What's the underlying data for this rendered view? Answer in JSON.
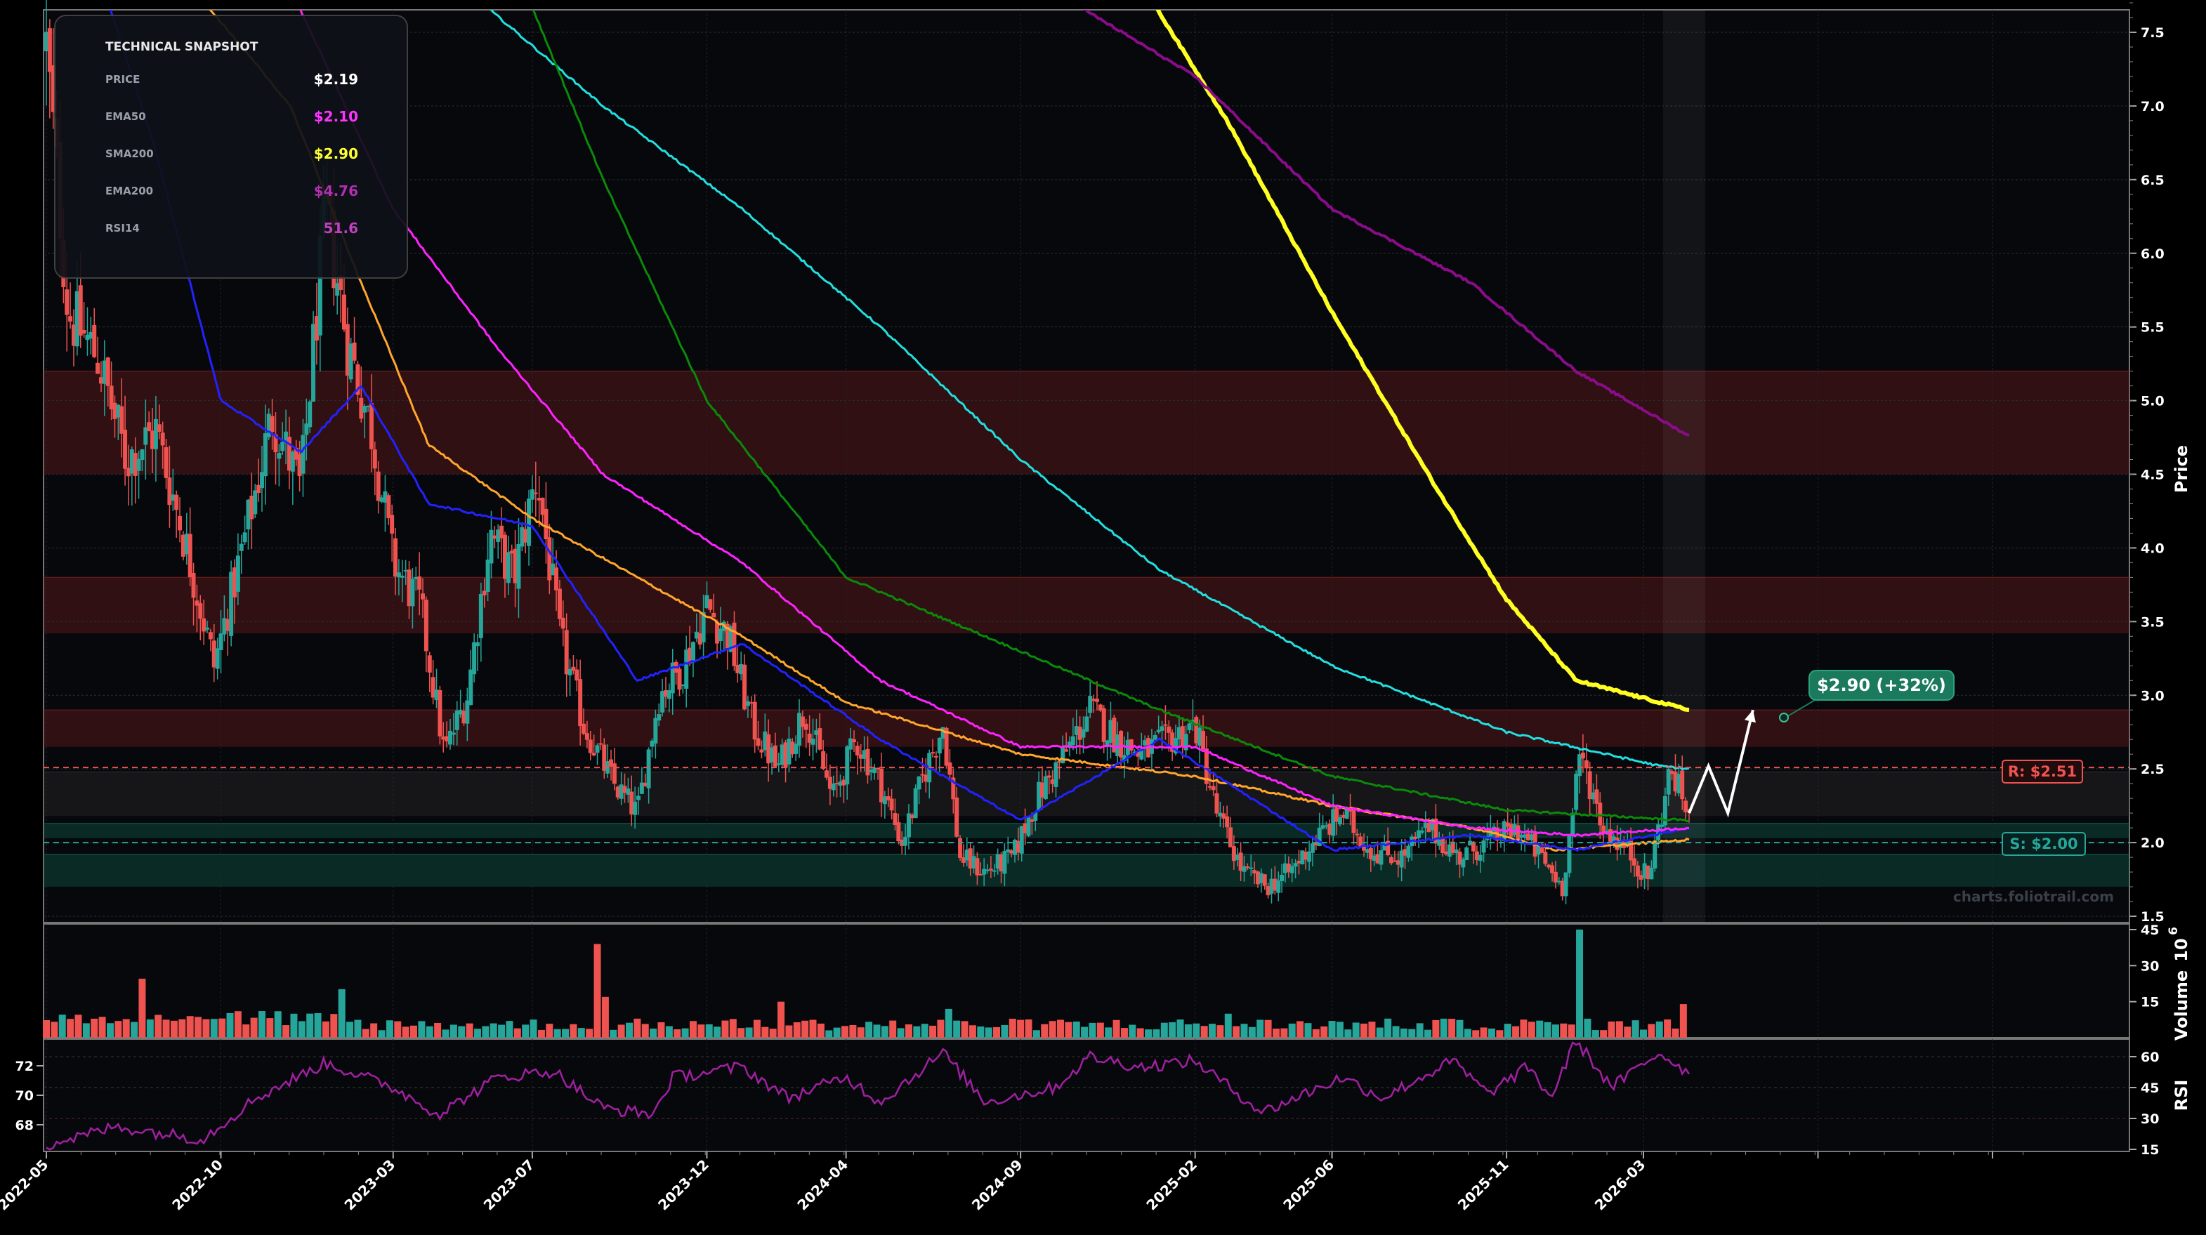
{
  "chart_data": {
    "type": "candlestick",
    "watermark": "charts.foliotrail.com",
    "price_axis": {
      "label": "Price",
      "ticks": [
        "1.5",
        "2.0",
        "2.5",
        "3.0",
        "3.5",
        "4.0",
        "4.5",
        "5.0",
        "5.5",
        "6.0",
        "6.5",
        "7.0",
        "7.5"
      ],
      "ylim": [
        1.45,
        7.85
      ]
    },
    "volume_axis": {
      "label": "Volume",
      "exponent": "1e6",
      "exponent_label": "6",
      "base_label": "10",
      "ticks": [
        "15",
        "30",
        "45"
      ],
      "ylim": [
        0,
        48
      ]
    },
    "rsi_axis": {
      "label": "RSI",
      "ticks_right": [
        "15",
        "30",
        "45",
        "60"
      ],
      "ticks_left": [
        "68",
        "70",
        "72"
      ],
      "ylim": [
        12,
        70
      ]
    },
    "x_ticks": [
      "2022-05",
      "2022-10",
      "2023-03",
      "2023-07",
      "2023-12",
      "2024-04",
      "2024-09",
      "2025-02",
      "2025-06",
      "2025-11",
      "2026-03"
    ],
    "snapshot": {
      "title": "TECHNICAL SNAPSHOT",
      "rows": [
        {
          "label": "PRICE",
          "value": "$2.19",
          "color": "#ffffff"
        },
        {
          "label": "EMA50",
          "value": "$2.10",
          "color": "#ff33ff"
        },
        {
          "label": "SMA200",
          "value": "$2.90",
          "color": "#ffff33"
        },
        {
          "label": "EMA200",
          "value": "$4.76",
          "color": "#b030b0"
        },
        {
          "label": "RSI14",
          "value": "51.6",
          "color": "#c040c0"
        }
      ]
    },
    "levels": {
      "resistance": {
        "label": "R: $2.51",
        "value": 2.51,
        "color": "#ef5350"
      },
      "support": {
        "label": "S: $2.00",
        "value": 2.0,
        "color": "#26a69a"
      }
    },
    "target": {
      "label": "$2.90 (+32%)",
      "value": 2.9,
      "color": "#1b7a5c"
    },
    "zones": [
      {
        "type": "resistance",
        "from": 4.5,
        "to": 5.2
      },
      {
        "type": "resistance",
        "from": 3.42,
        "to": 3.8
      },
      {
        "type": "resistance",
        "from": 2.65,
        "to": 2.9
      },
      {
        "type": "neutral",
        "from": 2.18,
        "to": 2.48
      },
      {
        "type": "support",
        "from": 2.03,
        "to": 2.13
      },
      {
        "type": "support",
        "from": 1.7,
        "to": 1.92
      }
    ],
    "anchors": [
      {
        "date": "2022-05-01",
        "close": 7.4
      },
      {
        "date": "2022-05-20",
        "close": 5.6
      },
      {
        "date": "2022-06-15",
        "close": 5.3
      },
      {
        "date": "2022-07-10",
        "close": 4.6
      },
      {
        "date": "2022-08-05",
        "close": 4.8
      },
      {
        "date": "2022-09-01",
        "close": 4.0
      },
      {
        "date": "2022-09-25",
        "close": 3.2
      },
      {
        "date": "2022-10-20",
        "close": 4.0
      },
      {
        "date": "2022-11-15",
        "close": 4.9
      },
      {
        "date": "2022-12-10",
        "close": 4.4
      },
      {
        "date": "2023-01-01",
        "close": 6.3
      },
      {
        "date": "2023-01-20",
        "close": 5.4
      },
      {
        "date": "2023-02-10",
        "close": 4.8
      },
      {
        "date": "2023-03-01",
        "close": 3.9
      },
      {
        "date": "2023-03-25",
        "close": 3.6
      },
      {
        "date": "2023-04-15",
        "close": 2.6
      },
      {
        "date": "2023-05-05",
        "close": 3.0
      },
      {
        "date": "2023-05-25",
        "close": 4.1
      },
      {
        "date": "2023-06-15",
        "close": 3.8
      },
      {
        "date": "2023-07-05",
        "close": 4.5
      },
      {
        "date": "2023-07-25",
        "close": 3.4
      },
      {
        "date": "2023-08-15",
        "close": 2.8
      },
      {
        "date": "2023-09-10",
        "close": 2.4
      },
      {
        "date": "2023-10-01",
        "close": 2.2
      },
      {
        "date": "2023-10-20",
        "close": 3.0
      },
      {
        "date": "2023-11-10",
        "close": 3.2
      },
      {
        "date": "2023-12-01",
        "close": 3.6
      },
      {
        "date": "2023-12-20",
        "close": 3.4
      },
      {
        "date": "2024-01-10",
        "close": 2.8
      },
      {
        "date": "2024-02-01",
        "close": 2.5
      },
      {
        "date": "2024-02-25",
        "close": 2.9
      },
      {
        "date": "2024-03-20",
        "close": 2.3
      },
      {
        "date": "2024-04-10",
        "close": 2.7
      },
      {
        "date": "2024-05-01",
        "close": 2.4
      },
      {
        "date": "2024-05-20",
        "close": 2.0
      },
      {
        "date": "2024-06-10",
        "close": 2.5
      },
      {
        "date": "2024-06-25",
        "close": 2.8
      },
      {
        "date": "2024-07-10",
        "close": 1.9
      },
      {
        "date": "2024-08-01",
        "close": 1.8
      },
      {
        "date": "2024-08-25",
        "close": 1.9
      },
      {
        "date": "2024-09-15",
        "close": 2.3
      },
      {
        "date": "2024-10-10",
        "close": 2.6
      },
      {
        "date": "2024-11-01",
        "close": 2.9
      },
      {
        "date": "2024-11-25",
        "close": 2.7
      },
      {
        "date": "2024-12-15",
        "close": 2.6
      },
      {
        "date": "2025-01-10",
        "close": 2.7
      },
      {
        "date": "2025-02-01",
        "close": 2.8
      },
      {
        "date": "2025-02-20",
        "close": 2.2
      },
      {
        "date": "2025-03-15",
        "close": 1.8
      },
      {
        "date": "2025-04-05",
        "close": 1.7
      },
      {
        "date": "2025-04-25",
        "close": 1.8
      },
      {
        "date": "2025-05-15",
        "close": 2.0
      },
      {
        "date": "2025-06-10",
        "close": 2.2
      },
      {
        "date": "2025-07-05",
        "close": 1.95
      },
      {
        "date": "2025-08-01",
        "close": 1.9
      },
      {
        "date": "2025-08-25",
        "close": 2.1
      },
      {
        "date": "2025-09-20",
        "close": 1.9
      },
      {
        "date": "2025-10-15",
        "close": 2.0
      },
      {
        "date": "2025-11-10",
        "close": 2.1
      },
      {
        "date": "2025-12-01",
        "close": 1.9
      },
      {
        "date": "2025-12-20",
        "close": 1.7
      },
      {
        "date": "2026-01-05",
        "close": 2.6
      },
      {
        "date": "2026-01-25",
        "close": 2.1
      },
      {
        "date": "2026-02-15",
        "close": 1.95
      },
      {
        "date": "2026-03-05",
        "close": 1.75
      },
      {
        "date": "2026-03-25",
        "close": 2.5
      },
      {
        "date": "2026-04-10",
        "close": 2.19
      }
    ],
    "ema_lines": {
      "cyan": [
        [
          "2022-05-01",
          9.5
        ],
        [
          "2023-01-01",
          8.6
        ],
        [
          "2023-09-01",
          7.0
        ],
        [
          "2024-01-01",
          6.3
        ],
        [
          "2024-05-01",
          5.5
        ],
        [
          "2024-09-01",
          4.6
        ],
        [
          "2025-01-01",
          3.85
        ],
        [
          "2025-06-01",
          3.2
        ],
        [
          "2025-11-01",
          2.75
        ],
        [
          "2026-03-15",
          2.52
        ],
        [
          "2026-04-10",
          2.5
        ]
      ],
      "green": [
        [
          "2022-05-01",
          14.0
        ],
        [
          "2023-02-01",
          10.5
        ],
        [
          "2023-09-01",
          6.5
        ],
        [
          "2023-12-01",
          5.0
        ],
        [
          "2024-04-01",
          3.8
        ],
        [
          "2024-08-01",
          3.4
        ],
        [
          "2025-01-01",
          2.9
        ],
        [
          "2025-06-01",
          2.45
        ],
        [
          "2025-11-01",
          2.22
        ],
        [
          "2026-04-10",
          2.15
        ]
      ],
      "orange": [
        [
          "2022-05-01",
          9.0
        ],
        [
          "2022-12-01",
          7.0
        ],
        [
          "2023-02-01",
          5.8
        ],
        [
          "2023-04-01",
          4.7
        ],
        [
          "2023-07-01",
          4.2
        ],
        [
          "2023-10-01",
          3.8
        ],
        [
          "2024-01-01",
          3.4
        ],
        [
          "2024-04-01",
          2.95
        ],
        [
          "2024-09-01",
          2.6
        ],
        [
          "2025-02-01",
          2.45
        ],
        [
          "2025-06-01",
          2.25
        ],
        [
          "2025-10-01",
          2.1
        ],
        [
          "2025-12-15",
          1.95
        ],
        [
          "2026-04-10",
          2.02
        ]
      ],
      "blue": [
        [
          "2022-05-01",
          9.0
        ],
        [
          "2022-08-01",
          6.8
        ],
        [
          "2022-10-01",
          5.0
        ],
        [
          "2022-12-10",
          4.65
        ],
        [
          "2023-02-01",
          5.1
        ],
        [
          "2023-04-01",
          4.3
        ],
        [
          "2023-07-01",
          4.15
        ],
        [
          "2023-10-01",
          3.1
        ],
        [
          "2024-01-01",
          3.35
        ],
        [
          "2024-05-01",
          2.7
        ],
        [
          "2024-09-01",
          2.15
        ],
        [
          "2025-01-01",
          2.7
        ],
        [
          "2025-06-01",
          1.95
        ],
        [
          "2025-10-01",
          2.05
        ],
        [
          "2026-01-01",
          1.95
        ],
        [
          "2026-04-10",
          2.1
        ]
      ],
      "magenta": [
        [
          "2022-05-01",
          12.0
        ],
        [
          "2022-12-01",
          7.8
        ],
        [
          "2023-03-01",
          6.3
        ],
        [
          "2023-06-01",
          5.35
        ],
        [
          "2023-09-01",
          4.5
        ],
        [
          "2024-01-01",
          3.9
        ],
        [
          "2024-05-01",
          3.1
        ],
        [
          "2024-09-01",
          2.65
        ],
        [
          "2025-02-01",
          2.65
        ],
        [
          "2025-06-01",
          2.25
        ],
        [
          "2025-10-01",
          2.1
        ],
        [
          "2026-01-01",
          2.05
        ],
        [
          "2026-04-10",
          2.1
        ]
      ],
      "yellow": [
        [
          "2024-12-10",
          7.9
        ],
        [
          "2025-03-01",
          6.9
        ],
        [
          "2025-06-01",
          5.6
        ],
        [
          "2025-09-01",
          4.4
        ],
        [
          "2025-11-01",
          3.65
        ],
        [
          "2026-01-01",
          3.1
        ],
        [
          "2026-04-10",
          2.9
        ]
      ],
      "purple": [
        [
          "2024-09-15",
          7.85
        ],
        [
          "2025-02-01",
          7.2
        ],
        [
          "2025-06-01",
          6.3
        ],
        [
          "2025-10-01",
          5.8
        ],
        [
          "2026-01-01",
          5.2
        ],
        [
          "2026-04-10",
          4.76
        ]
      ]
    },
    "ema_colors": {
      "cyan": "#22e0e0",
      "green": "#0a8a0a",
      "orange": "#ffa62b",
      "blue": "#2222ff",
      "magenta": "#ff22ff",
      "yellow": "#ffff22",
      "purple": "#8b0c8b"
    },
    "projection": [
      [
        "2026-04-10",
        2.2
      ],
      [
        "2026-04-27",
        2.52
      ],
      [
        "2026-05-14",
        2.2
      ],
      [
        "2026-06-05",
        2.9
      ]
    ],
    "volume_spikes": [
      [
        "2022-07-25",
        23
      ],
      [
        "2023-01-15",
        18
      ],
      [
        "2023-08-25",
        39
      ],
      [
        "2023-09-01",
        17
      ],
      [
        "2024-02-01",
        15
      ],
      [
        "2024-07-01",
        12
      ],
      [
        "2025-03-01",
        10
      ],
      [
        "2026-01-01",
        45
      ],
      [
        "2026-04-05",
        14
      ]
    ],
    "rsi_anchors": [
      [
        "2022-05-01",
        17
      ],
      [
        "2022-07-01",
        26
      ],
      [
        "2022-09-15",
        20
      ],
      [
        "2022-11-01",
        40
      ],
      [
        "2023-01-01",
        57
      ],
      [
        "2023-03-01",
        45
      ],
      [
        "2023-04-10",
        32
      ],
      [
        "2023-06-01",
        50
      ],
      [
        "2023-07-20",
        53
      ],
      [
        "2023-09-01",
        35
      ],
      [
        "2023-10-15",
        32
      ],
      [
        "2023-11-01",
        50
      ],
      [
        "2024-01-01",
        55
      ],
      [
        "2024-02-10",
        40
      ],
      [
        "2024-04-01",
        50
      ],
      [
        "2024-05-01",
        38
      ],
      [
        "2024-06-25",
        62
      ],
      [
        "2024-08-01",
        38
      ],
      [
        "2024-10-01",
        45
      ],
      [
        "2024-11-01",
        60
      ],
      [
        "2024-12-15",
        55
      ],
      [
        "2025-02-01",
        58
      ],
      [
        "2025-04-01",
        33
      ],
      [
        "2025-06-10",
        50
      ],
      [
        "2025-07-15",
        40
      ],
      [
        "2025-09-15",
        58
      ],
      [
        "2025-10-15",
        42
      ],
      [
        "2025-11-20",
        55
      ],
      [
        "2025-12-10",
        40
      ],
      [
        "2026-01-01",
        68
      ],
      [
        "2026-02-01",
        45
      ],
      [
        "2026-03-15",
        62
      ],
      [
        "2026-04-10",
        52
      ]
    ]
  }
}
